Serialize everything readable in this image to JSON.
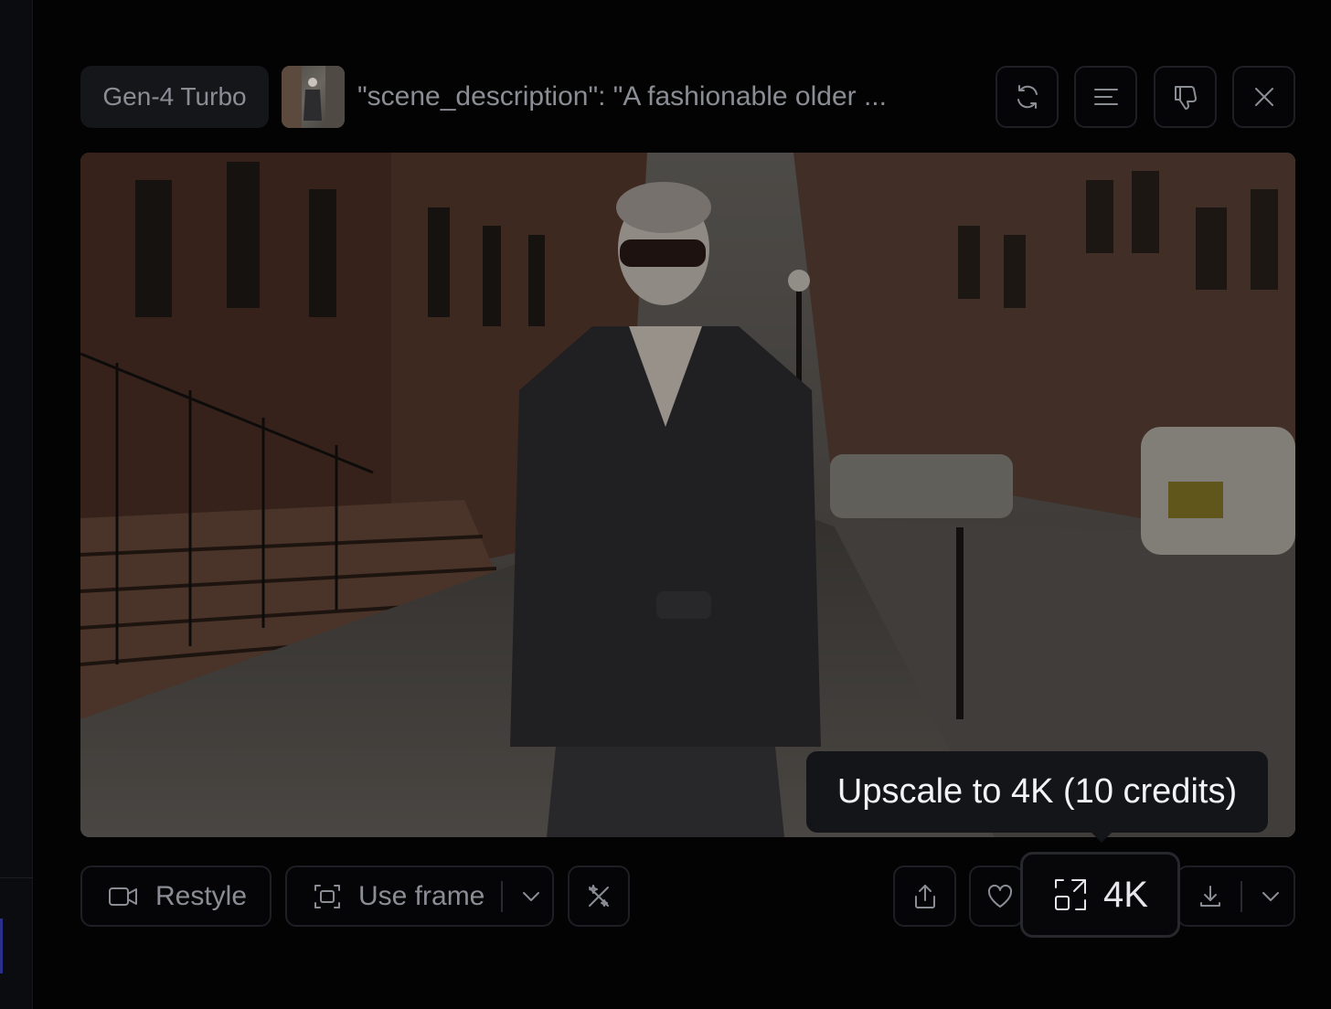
{
  "header": {
    "model_label": "Gen-4 Turbo",
    "prompt_preview": "\"scene_description\": \"A fashionable older ...",
    "thumbnail_icon": "video-thumbnail",
    "actions": [
      {
        "name": "regenerate",
        "icon": "refresh-icon"
      },
      {
        "name": "details",
        "icon": "align-left-icon"
      },
      {
        "name": "dislike",
        "icon": "thumbs-down-icon"
      },
      {
        "name": "close",
        "icon": "close-icon"
      }
    ]
  },
  "video": {
    "subject": "video-frame"
  },
  "tooltip": {
    "text": "Upscale to 4K (10 credits)"
  },
  "toolbar": {
    "restyle_label": "Restyle",
    "use_frame_label": "Use frame",
    "upscale_label": "4K",
    "icons": {
      "restyle": "video-camera-icon",
      "use_frame": "frame-capture-icon",
      "magic": "magic-wand-icon",
      "share": "share-icon",
      "like": "heart-icon",
      "upscale": "upscale-icon",
      "download": "download-icon",
      "chevron": "chevron-down-icon"
    }
  },
  "colors": {
    "background": "#030304",
    "surface": "#15161a",
    "border": "#1e1f24",
    "text_muted": "#8b8d95",
    "tooltip_text": "#f3f3f5"
  }
}
